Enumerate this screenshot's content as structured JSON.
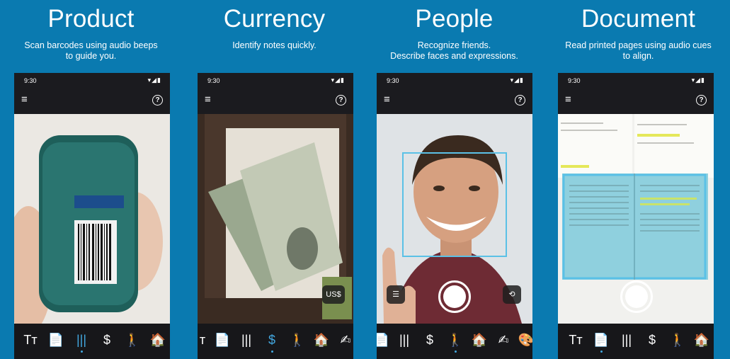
{
  "panels": [
    {
      "title": "Product",
      "description": "Scan barcodes using audio beeps\nto guide you.",
      "time": "9:30",
      "tabs": [
        "Tт",
        "📄",
        "|||",
        "$",
        "🚶",
        "🏠"
      ]
    },
    {
      "title": "Currency",
      "description": "Identify notes quickly.",
      "time": "9:30",
      "badge": "US$",
      "tabs": [
        "т",
        "📄",
        "|||",
        "$",
        "🚶",
        "🏠",
        "✍"
      ]
    },
    {
      "title": "People",
      "description": "Recognize friends.\nDescribe faces and expressions.",
      "time": "9:30",
      "tabs": [
        "📄",
        "|||",
        "$",
        "🚶",
        "🏠",
        "✍",
        "🎨"
      ]
    },
    {
      "title": "Document",
      "description": "Read printed pages using audio cues\nto align.",
      "time": "9:30",
      "tabs": [
        "Tт",
        "📄",
        "|||",
        "$",
        "🚶",
        "🏠"
      ]
    }
  ],
  "icons": {
    "status": "▾◢▮",
    "menu": "≡",
    "help": "?"
  }
}
